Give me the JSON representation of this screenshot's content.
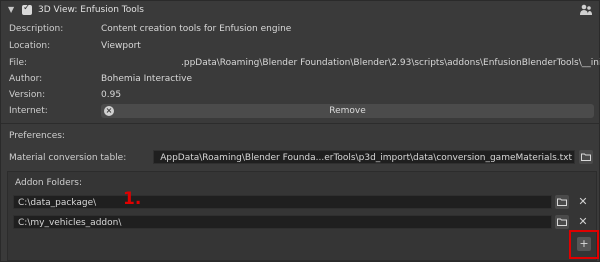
{
  "header": {
    "title": "3D View: Enfusion Tools",
    "enabled": true
  },
  "info": [
    {
      "label": "Description:",
      "value": "Content creation tools for Enfusion engine"
    },
    {
      "label": "Location:",
      "value": "Viewport"
    },
    {
      "label": "File:",
      "value": ".ppData\\Roaming\\Blender Foundation\\Blender\\2.93\\scripts\\addons\\EnfusionBlenderTools\\__init__.py"
    },
    {
      "label": "Author:",
      "value": "Bohemia Interactive"
    },
    {
      "label": "Version:",
      "value": "0.95"
    },
    {
      "label": "Internet:",
      "value": ""
    }
  ],
  "remove_label": "Remove",
  "preferences": {
    "label": "Preferences:",
    "material_label": "Material conversion table:",
    "material_value": "AppData\\Roaming\\Blender Founda...erTools\\p3d_import\\data\\conversion_gameMaterials.txt"
  },
  "addon_folders": {
    "label": "Addon Folders:",
    "paths": [
      "C:\\data_package\\",
      "C:\\my_vehicles_addon\\"
    ]
  },
  "annotation": "1.",
  "icons": {
    "expand": "chevron-down-icon",
    "user": "users-icon",
    "remove": "x-circle-icon",
    "folder": "folder-icon",
    "delete": "close-icon",
    "add": "plus-icon"
  },
  "colors": {
    "highlight": "#e00000",
    "panel": "#3a3a3a",
    "field": "#1f1f1f"
  }
}
